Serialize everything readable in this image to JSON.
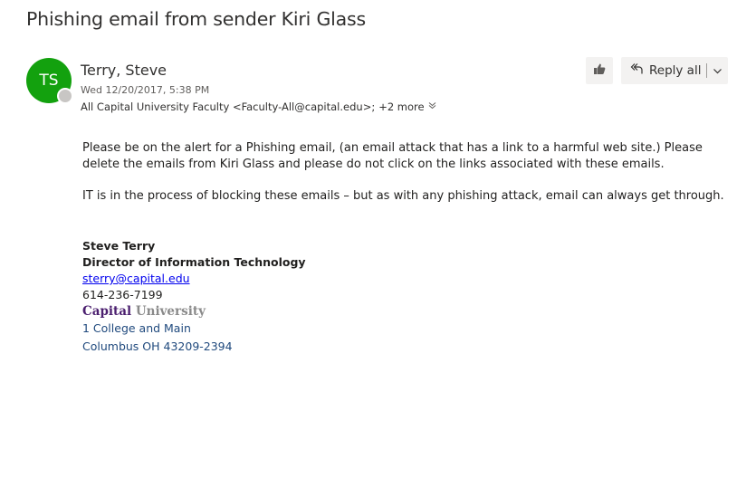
{
  "email": {
    "subject": "Phishing email from sender Kiri Glass",
    "avatar_initials": "TS",
    "avatar_color": "#13a10e",
    "sender": "Terry, Steve",
    "datetime": "Wed 12/20/2017, 5:38 PM",
    "recipients": "All Capital University Faculty <Faculty-All@capital.edu>;",
    "more_recipients": "+2 more",
    "more_icon": "double-chevron-down-icon"
  },
  "toolbar": {
    "like_icon": "thumbs-up-icon",
    "reply_all_label": "Reply all",
    "reply_all_icon": "reply-all-icon",
    "reply_menu_icon": "chevron-down-icon"
  },
  "body": {
    "paragraph1": "Please be on the alert for a Phishing email, (an email attack that has a link to a harmful web site.)  Please delete the emails from Kiri Glass and please do not click on the links associated with these emails.",
    "paragraph2": "IT is in the process of blocking these emails – but as with any phishing attack, email can always get through."
  },
  "signature": {
    "name": "Steve Terry",
    "title": "Director of Information Technology",
    "email": "sterry@capital.edu",
    "phone": "614-236-7199",
    "brand_part1": "Capital",
    "brand_part2": "University",
    "address_line1": "1 College and Main",
    "address_line2": "Columbus OH  43209-2394"
  },
  "colors": {
    "link": "#0000ee",
    "brand_purple": "#4b1f6f",
    "address_blue": "#1f497d",
    "button_bg": "#f3f2f1"
  }
}
